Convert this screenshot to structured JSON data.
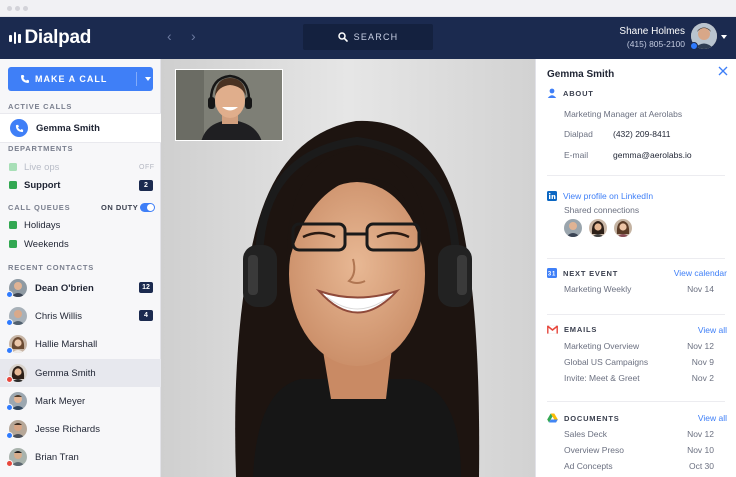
{
  "app": {
    "name": "Dialpad"
  },
  "header": {
    "search_label": "SEARCH",
    "user_name": "Shane Holmes",
    "user_phone": "(415) 805-2100"
  },
  "sidebar": {
    "make_call_label": "MAKE A CALL",
    "active_calls_heading": "ACTIVE CALLS",
    "active_call_name": "Gemma Smith",
    "departments_heading": "DEPARTMENTS",
    "departments": [
      {
        "name": "Live ops",
        "status": "OFF"
      },
      {
        "name": "Support",
        "count": "2"
      }
    ],
    "call_queues_heading": "CALL QUEUES",
    "on_duty_label": "ON DUTY",
    "queues": [
      {
        "name": "Holidays"
      },
      {
        "name": "Weekends"
      }
    ],
    "recent_contacts_heading": "RECENT CONTACTS",
    "contacts": [
      {
        "name": "Dean O'brien",
        "count": "12"
      },
      {
        "name": "Chris Willis",
        "count": "4"
      },
      {
        "name": "Hallie Marshall"
      },
      {
        "name": "Gemma Smith"
      },
      {
        "name": "Mark Meyer"
      },
      {
        "name": "Jesse Richards"
      },
      {
        "name": "Brian Tran"
      }
    ]
  },
  "panel": {
    "contact_name": "Gemma Smith",
    "about_heading": "ABOUT",
    "about_title": "Marketing Manager at Aerolabs",
    "dialpad_label": "Dialpad",
    "dialpad_value": "(432) 209-8411",
    "email_label": "E-mail",
    "email_value": "gemma@aerolabs.io",
    "linkedin_link": "View profile on LinkedIn",
    "shared_connections": "Shared connections",
    "next_event_heading": "NEXT EVENT",
    "next_event_link": "View calendar",
    "calendar_day": "31",
    "event": {
      "title": "Marketing Weekly",
      "date": "Nov 14"
    },
    "emails_heading": "EMAILS",
    "emails_link": "View all",
    "emails": [
      {
        "subject": "Marketing Overview",
        "date": "Nov 12"
      },
      {
        "subject": "Global US Campaigns",
        "date": "Nov 9"
      },
      {
        "subject": "Invite: Meet & Greet",
        "date": "Nov 2"
      }
    ],
    "documents_heading": "DOCUMENTS",
    "documents_link": "View all",
    "documents": [
      {
        "name": "Sales Deck",
        "date": "Nov 12"
      },
      {
        "name": "Overview Preso",
        "date": "Nov 10"
      },
      {
        "name": "Ad Concepts",
        "date": "Oct 30"
      }
    ]
  },
  "colors": {
    "navy": "#1b2a4f",
    "accent_blue": "#3f7ff7",
    "department_green": "#32a852",
    "status_available": "#2f7bff",
    "status_busy": "#e8473c"
  },
  "icons": [
    "phone-icon",
    "search-icon",
    "chevron-left-icon",
    "chevron-right-icon",
    "close-icon",
    "person-icon",
    "linkedin-icon",
    "calendar-icon",
    "gmail-icon",
    "google-drive-icon"
  ]
}
